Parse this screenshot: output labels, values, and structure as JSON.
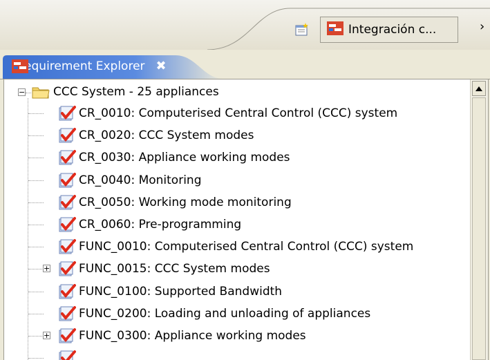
{
  "perspective": {
    "button_label": "Integración c...",
    "open_icon": "open-perspective-icon",
    "chevron": "›"
  },
  "view": {
    "tab_label": "Requirement Explorer",
    "close_glyph": "✖",
    "toolbar_icons": [
      "import-icon",
      "delete-red-x-icon",
      "refresh-icon",
      "filter-icon",
      "minimize-icon",
      "maximize-icon"
    ]
  },
  "tree": {
    "root_label": "CCC System - 25 appliances",
    "items": [
      {
        "label": "CR_0010: Computerised Central Control (CCC) system",
        "expandable": false
      },
      {
        "label": "CR_0020: CCC System modes",
        "expandable": false
      },
      {
        "label": "CR_0030: Appliance working modes",
        "expandable": false
      },
      {
        "label": "CR_0040: Monitoring",
        "expandable": false
      },
      {
        "label": "CR_0050: Working mode monitoring",
        "expandable": false
      },
      {
        "label": "CR_0060: Pre-programming",
        "expandable": false
      },
      {
        "label": "FUNC_0010: Computerised Central Control (CCC) system",
        "expandable": false
      },
      {
        "label": "FUNC_0015: CCC System modes",
        "expandable": true
      },
      {
        "label": "FUNC_0100: Supported Bandwidth",
        "expandable": false
      },
      {
        "label": "FUNC_0200: Loading and unloading of appliances",
        "expandable": false
      },
      {
        "label": "FUNC_0300: Appliance working modes",
        "expandable": true
      },
      {
        "label": "",
        "expandable": false
      }
    ]
  },
  "colors": {
    "tab_gradient_start": "#d8452c",
    "tab_gradient_end": "#2f6fd6",
    "check_red": "#e02a1a"
  }
}
